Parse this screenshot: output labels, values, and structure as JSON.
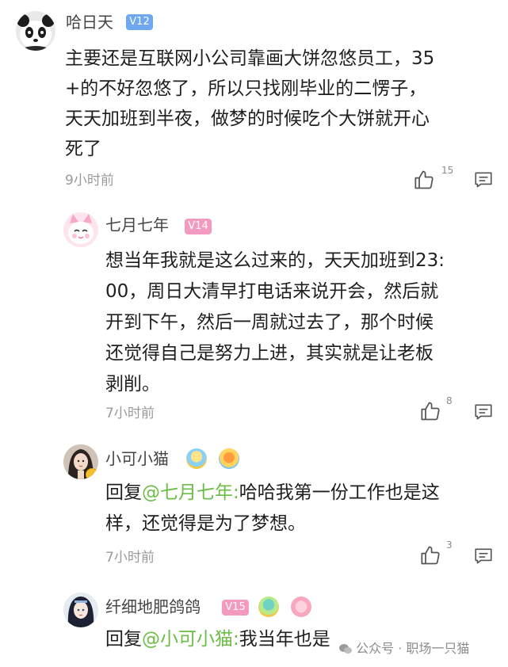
{
  "comments": [
    {
      "username": "哈日天",
      "level": "V12",
      "lines": [
        "主要还是互联网小公司靠画大饼忽悠员工，35",
        "+的不好忽悠了，所以只找刚毕业的二愣子，",
        "天天加班到半夜，做梦的时候吃个大饼就开心",
        "死了"
      ],
      "time": "9小时前",
      "likes": "15"
    },
    {
      "username": "七月七年",
      "level": "V14",
      "lines": [
        "想当年我就是这么过来的，天天加班到23:",
        "00，周日大清早打电话来说开会，然后就",
        "开到下午，然后一周就过去了，那个时候",
        "还觉得自己是努力上进，其实就是让老板",
        "剥削。"
      ],
      "time": "7小时前",
      "likes": "8"
    },
    {
      "username": "小可小猫",
      "reply_prefix": "回复",
      "reply_to": "@七月七年:",
      "lines": [
        "哈哈我第一份工作也是这",
        "样，还觉得是为了梦想。"
      ],
      "time": "7小时前",
      "likes": "3"
    },
    {
      "username": "纤细地肥鸽鸽",
      "level": "V15",
      "reply_prefix": "回复",
      "reply_to": "@小可小猫:",
      "lines": [
        "我当年也是"
      ]
    }
  ],
  "watermark": "公众号 · 职场一只猫",
  "icons": {
    "like": "thumbs-up-icon",
    "reply": "comment-icon"
  },
  "colors": {
    "level_badge": "#6fa8f2",
    "level_badge_pink": "#f49ac1",
    "mention": "#6cbd45"
  }
}
